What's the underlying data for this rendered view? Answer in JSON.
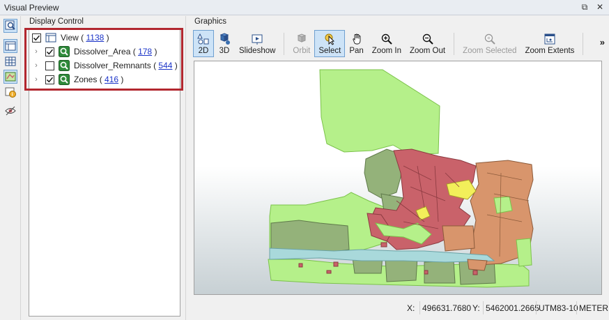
{
  "window": {
    "title": "Visual Preview",
    "buttons": [
      {
        "name": "restore",
        "glyph": "⧉"
      },
      {
        "name": "close",
        "glyph": "✕"
      }
    ]
  },
  "left_toolbar": {
    "tools": [
      "inspector-icon",
      "panel-layout-icon",
      "table-icon",
      "map-layers-icon",
      "info-icon",
      "view-settings-icon"
    ]
  },
  "display_control": {
    "label": "Display Control",
    "view": {
      "label": "View",
      "open": "(",
      "count": "1138",
      "close": ")",
      "checked": true
    },
    "layers": [
      {
        "label": "Dissolver_Area",
        "open": "(",
        "count": "178",
        "close": ")",
        "checked": true
      },
      {
        "label": "Dissolver_Remnants",
        "open": "(",
        "count": "544",
        "close": ")",
        "checked": false
      },
      {
        "label": "Zones",
        "open": "(",
        "count": "416",
        "close": ")",
        "checked": true
      }
    ]
  },
  "graphics": {
    "label": "Graphics",
    "toolbar": {
      "b2d": "2D",
      "b3d": "3D",
      "slideshow": "Slideshow",
      "orbit": "Orbit",
      "select": "Select",
      "pan": "Pan",
      "zoom_in": "Zoom In",
      "zoom_out": "Zoom Out",
      "zoom_selected": "Zoom Selected",
      "zoom_extents": "Zoom Extents",
      "more": "»"
    }
  },
  "status": {
    "x_label": "X:",
    "x_value": "496631.7680",
    "y_label": "Y:",
    "y_value": "5462001.2665",
    "crs": "UTM83-10",
    "units": "METER"
  },
  "colors": {
    "accent": "#b2272f",
    "selected_fill": "#cde3f7",
    "selected_border": "#6fa0d0",
    "map_green": "#b5f08a",
    "map_red": "#c9626a",
    "map_orange": "#d8956c",
    "map_darkgreen": "#94b27a",
    "map_yellow": "#f2ef5a",
    "map_cyan": "#a9d9db"
  }
}
